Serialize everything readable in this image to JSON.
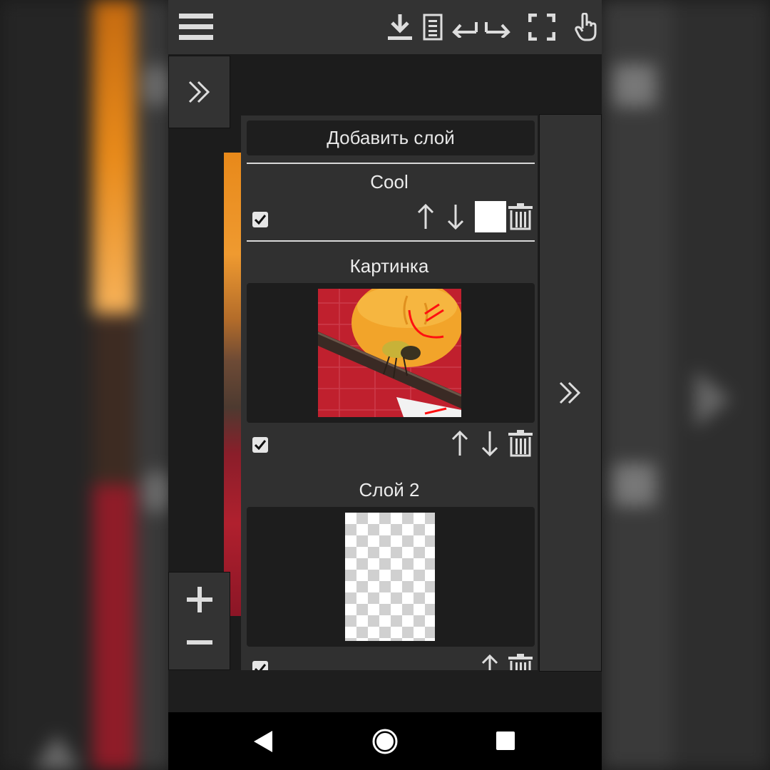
{
  "toolbar": {
    "icons": [
      "menu-icon",
      "download-icon",
      "document-icon",
      "undo-icon",
      "redo-icon",
      "fullscreen-icon",
      "hand-icon"
    ]
  },
  "layers_panel": {
    "add_layer_label": "Добавить слой",
    "layers": [
      {
        "name": "Cool",
        "visible": true,
        "color_swatch": "#ffffff"
      },
      {
        "name": "Картинка",
        "visible": true
      },
      {
        "name": "Слой 2",
        "visible": true
      }
    ]
  },
  "navigation_bar": {
    "icons": [
      "back-icon",
      "home-icon",
      "recents-icon"
    ]
  }
}
